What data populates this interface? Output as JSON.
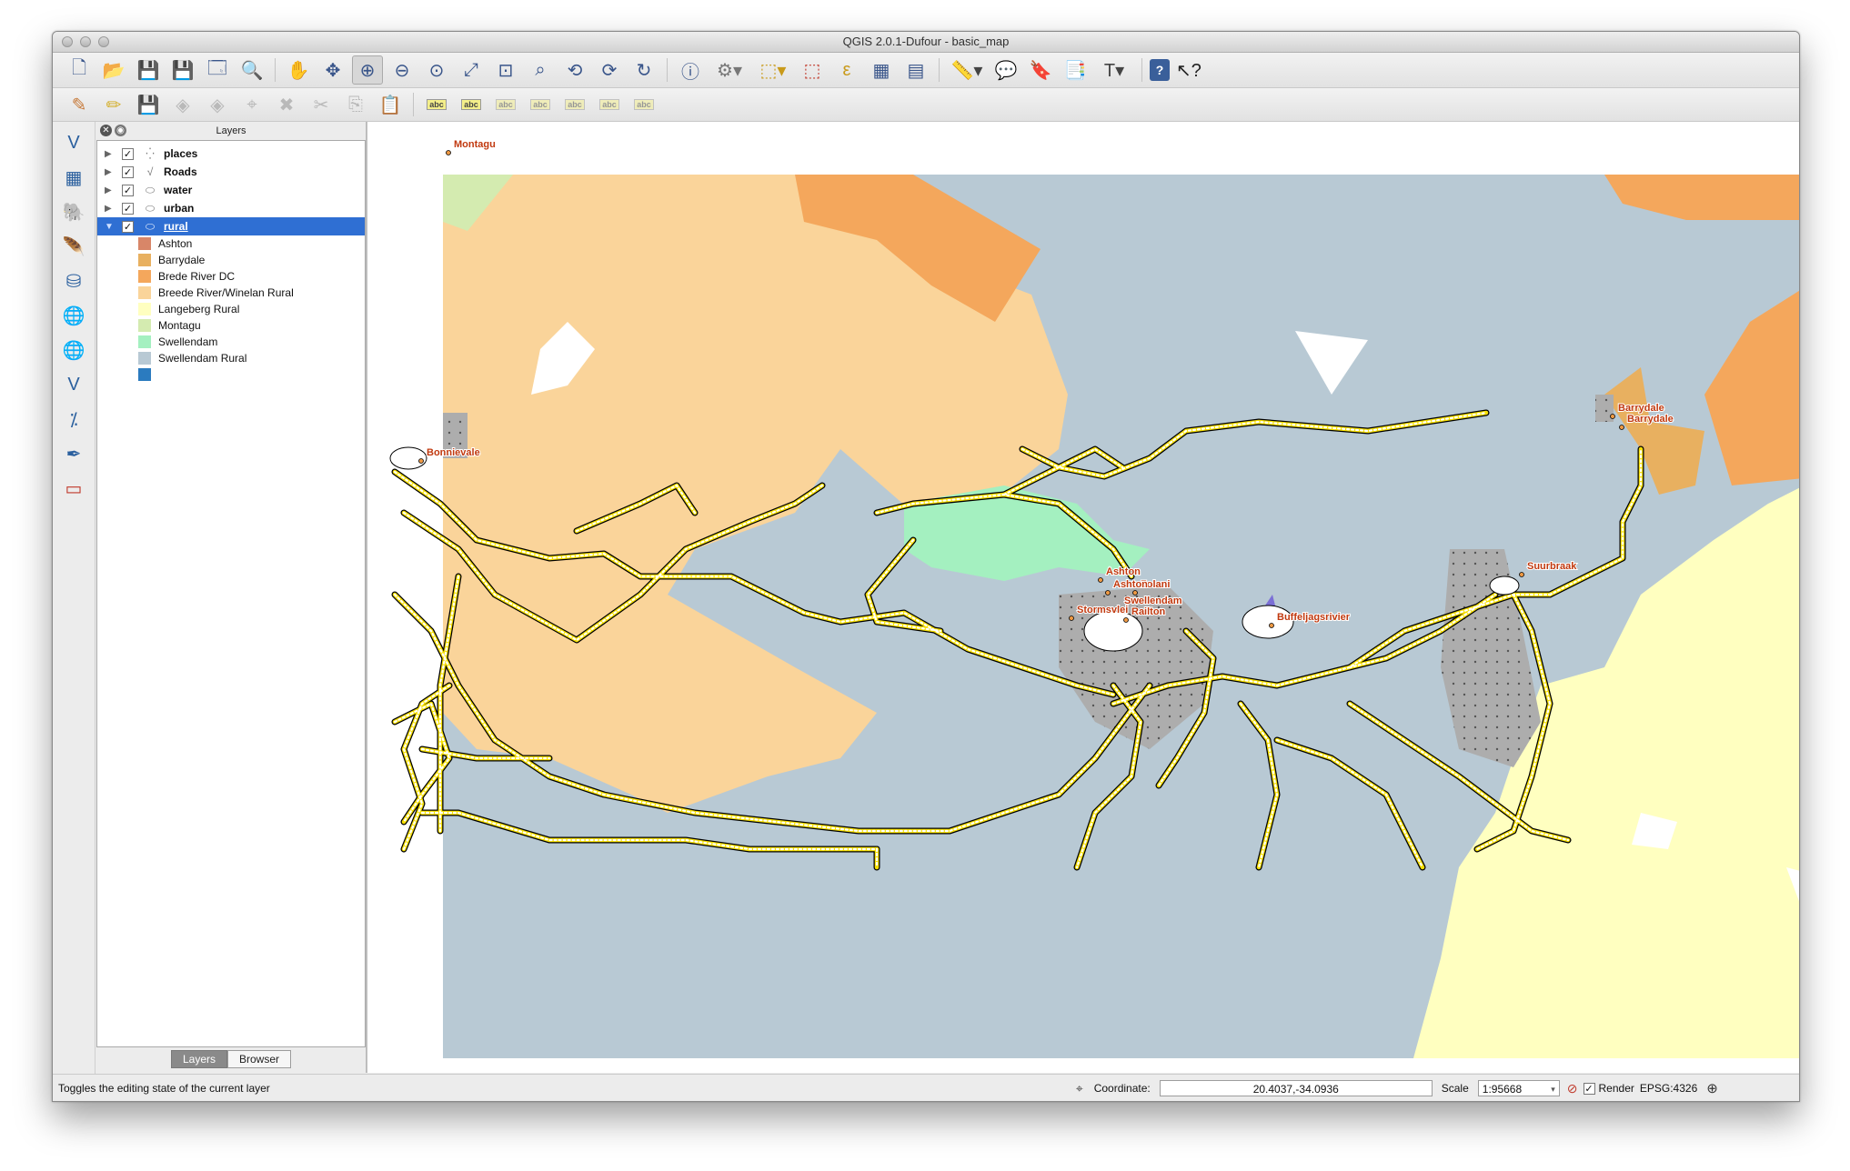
{
  "window": {
    "title": "QGIS 2.0.1-Dufour - basic_map"
  },
  "toolbar1": {
    "icons": [
      "new-project-icon",
      "open-project-icon",
      "save-project-icon",
      "save-as-icon",
      "print-composer-icon",
      "composer-manager-icon",
      "pan-icon",
      "pan-to-selection-icon",
      "zoom-in-icon",
      "zoom-out-icon",
      "zoom-actual-icon",
      "zoom-full-icon",
      "zoom-to-selection-icon",
      "zoom-to-layer-icon",
      "zoom-last-icon",
      "zoom-next-icon",
      "refresh-icon",
      "identify-icon",
      "run-action-icon",
      "select-icon",
      "deselect-icon",
      "expression-select-icon",
      "attribute-table-icon",
      "field-calculator-icon",
      "measure-icon",
      "map-tips-icon",
      "new-bookmark-icon",
      "show-bookmarks-icon",
      "text-annotation-icon",
      "help-icon",
      "whats-this-icon"
    ]
  },
  "toolbar2": {
    "icons": [
      "toggle-editing-icon",
      "current-edits-icon",
      "save-edits-icon",
      "add-feature-icon",
      "move-feature-icon",
      "node-tool-icon",
      "delete-selected-icon",
      "cut-features-icon",
      "copy-features-icon",
      "paste-features-icon",
      "label-tool-icon",
      "layer-labeling-icon",
      "pin-labels-icon",
      "show-hide-labels-icon",
      "move-label-icon",
      "rotate-label-icon",
      "change-label-icon"
    ]
  },
  "left_toolbar": {
    "icons": [
      "add-vector-layer-icon",
      "add-raster-layer-icon",
      "add-postgis-layer-icon",
      "add-spatialite-layer-icon",
      "add-mssql-layer-icon",
      "add-wms-layer-icon",
      "add-wcs-layer-icon",
      "add-wfs-layer-icon",
      "add-delimited-text-icon",
      "new-shapefile-icon",
      "remove-layer-icon"
    ]
  },
  "layers_panel": {
    "title": "Layers",
    "layers": [
      {
        "name": "places",
        "checked": "✓",
        "icon": "point-layer-icon"
      },
      {
        "name": "Roads",
        "checked": "✓",
        "icon": "line-layer-icon"
      },
      {
        "name": "water",
        "checked": "✓",
        "icon": "polygon-layer-icon"
      },
      {
        "name": "urban",
        "checked": "✓",
        "icon": "polygon-layer-icon"
      },
      {
        "name": "rural",
        "checked": "✓",
        "icon": "polygon-layer-icon",
        "selected": true
      }
    ],
    "legend": [
      {
        "label": "Ashton",
        "color": "#d88668"
      },
      {
        "label": "Barrydale",
        "color": "#e8b060"
      },
      {
        "label": "Brede River DC",
        "color": "#f4a75c"
      },
      {
        "label": "Breede River/Winelan Rural",
        "color": "#fad49a"
      },
      {
        "label": "Langeberg Rural",
        "color": "#ffffc0"
      },
      {
        "label": "Montagu",
        "color": "#d4ebb0"
      },
      {
        "label": "Swellendam",
        "color": "#a4f0c0"
      },
      {
        "label": "Swellendam Rural",
        "color": "#b8c9d4"
      },
      {
        "label": "",
        "color": "#2b7bbf"
      }
    ],
    "tabs": [
      "Layers",
      "Browser"
    ]
  },
  "map": {
    "labels": [
      "Montagu",
      "Bonnievale",
      "Barrydale",
      "Barrydale",
      "Suurbraak",
      "Ashton",
      "Swellendam",
      "Buffeljagsrivier",
      "Railton",
      "Stormsvlei",
      "Zolani",
      "Ashton"
    ]
  },
  "statusbar": {
    "message": "Toggles the editing state of the current layer",
    "coordinate_label": "Coordinate:",
    "coordinate_value": "20.4037,-34.0936",
    "scale_label": "Scale",
    "scale_value": "1:95668",
    "render_label": "Render",
    "render_checked": "✓",
    "crs": "EPSG:4326"
  }
}
